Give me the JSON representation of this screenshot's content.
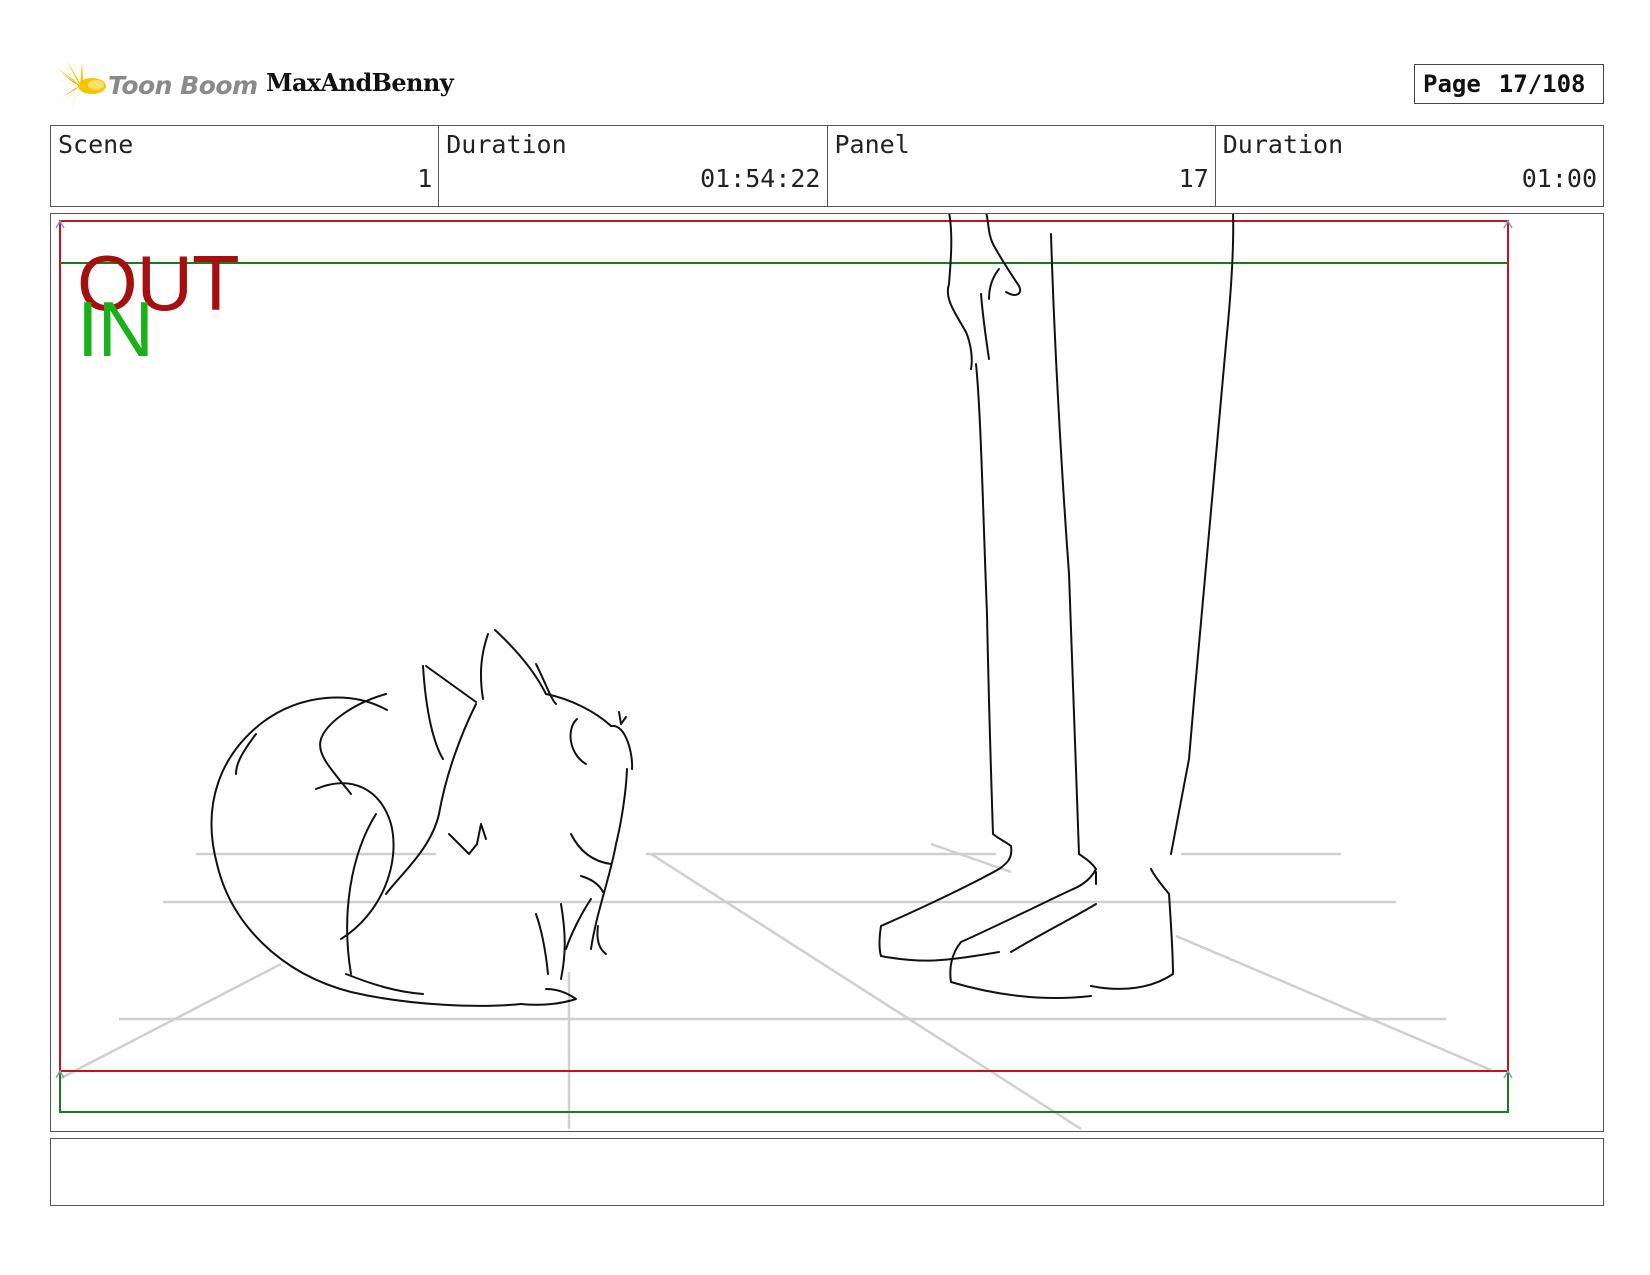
{
  "header": {
    "logo_text": "Toon Boom",
    "logo_icon": "starburst-icon",
    "project_name": "MaxAndBenny",
    "page_label": "Page",
    "page_value": "17/108"
  },
  "info": {
    "scene_label": "Scene",
    "scene_value": "1",
    "duration_label": "Duration",
    "duration_value": "01:54:22",
    "panel_label": "Panel",
    "panel_value": "17",
    "panel_duration_label": "Duration",
    "panel_duration_value": "01:00"
  },
  "frame": {
    "out_label": "OUT",
    "in_label": "IN",
    "colors": {
      "out": "#a50f0f",
      "in": "#19b019",
      "red_frame": "#c0141e",
      "green_frame": "#1b7a1b"
    }
  },
  "notes": {
    "text": ""
  }
}
